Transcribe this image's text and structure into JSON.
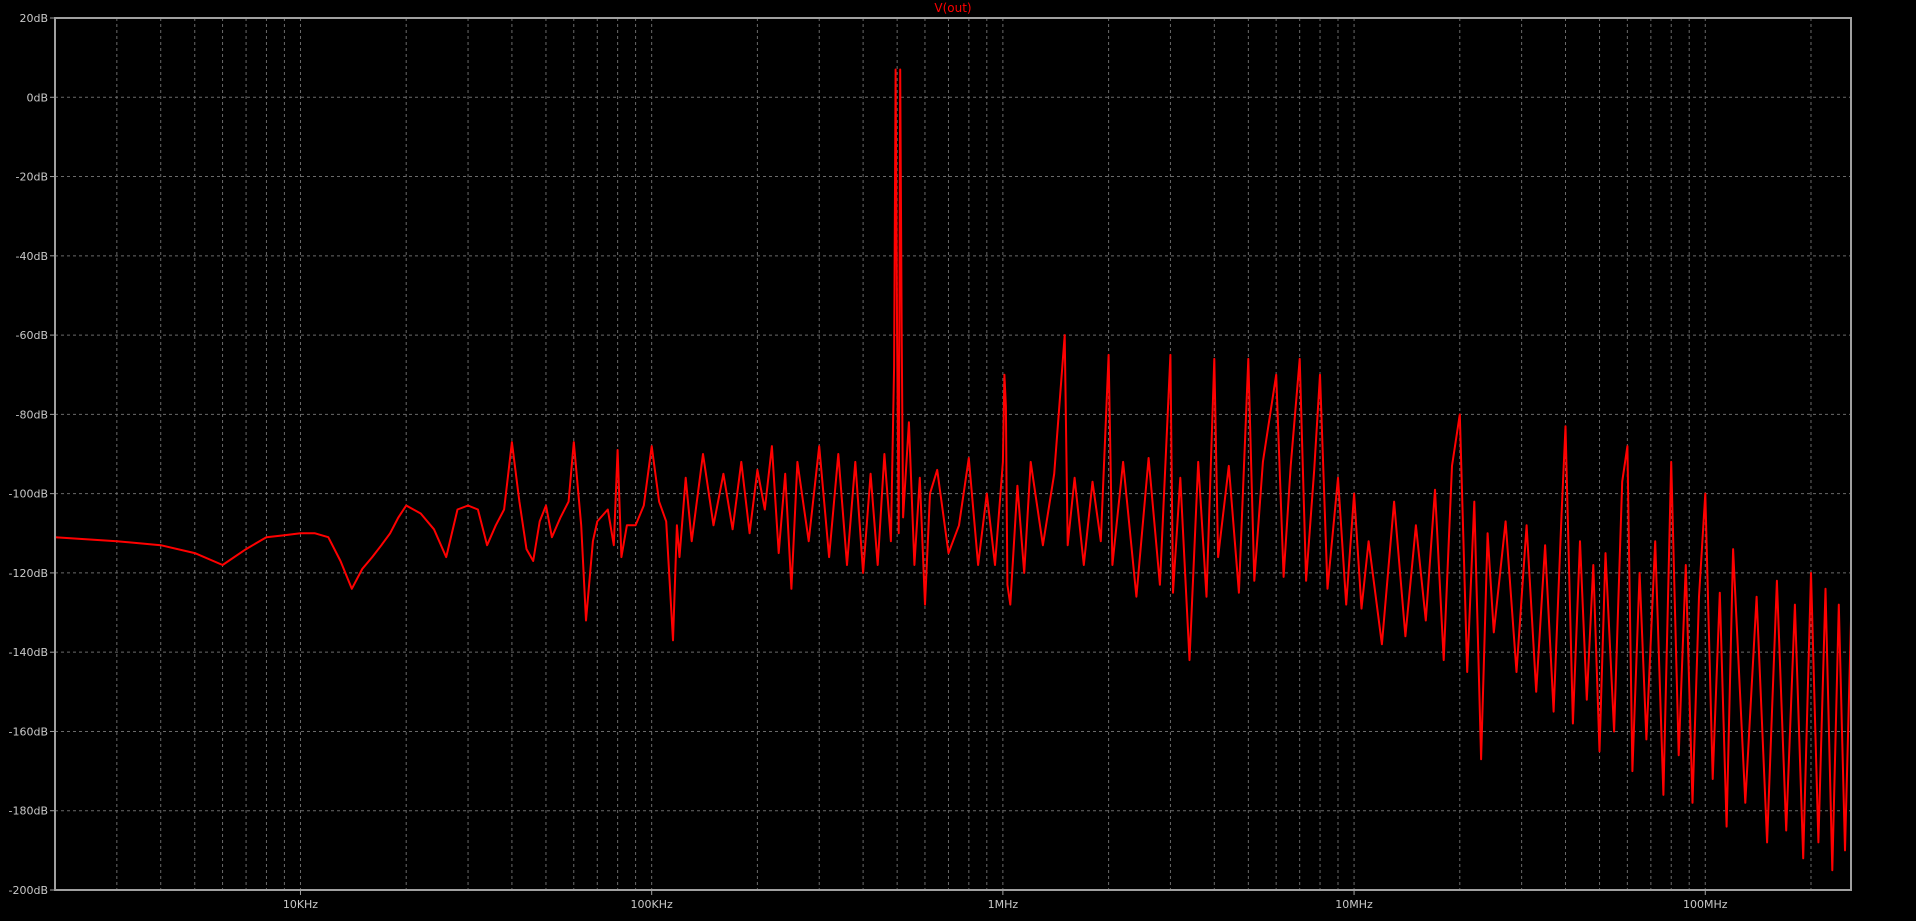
{
  "colors": {
    "background": "#000000",
    "trace": "#ff0000",
    "axis": "#a0a0a0",
    "grid": "#6a6a6a",
    "tick_label": "#c8c8c8"
  },
  "chart_data": {
    "type": "line",
    "title": "V(out)",
    "xlabel": "",
    "ylabel": "",
    "x_scale": "log",
    "xlim": [
      2000,
      260000000
    ],
    "ylim": [
      -200,
      20
    ],
    "grid": true,
    "legend": "none",
    "x_ticks": [
      {
        "value": 10000,
        "label": "10KHz"
      },
      {
        "value": 100000,
        "label": "100KHz"
      },
      {
        "value": 1000000,
        "label": "1MHz"
      },
      {
        "value": 10000000,
        "label": "10MHz"
      },
      {
        "value": 100000000,
        "label": "100MHz"
      }
    ],
    "y_ticks": [
      {
        "value": 20,
        "label": "20dB"
      },
      {
        "value": 0,
        "label": "0dB"
      },
      {
        "value": -20,
        "label": "-20dB"
      },
      {
        "value": -40,
        "label": "-40dB"
      },
      {
        "value": -60,
        "label": "-60dB"
      },
      {
        "value": -80,
        "label": "-80dB"
      },
      {
        "value": -100,
        "label": "-100dB"
      },
      {
        "value": -120,
        "label": "-120dB"
      },
      {
        "value": -140,
        "label": "-140dB"
      },
      {
        "value": -160,
        "label": "-160dB"
      },
      {
        "value": -180,
        "label": "-180dB"
      },
      {
        "value": -200,
        "label": "-200dB"
      }
    ],
    "series": [
      {
        "values": [
          [
            2000,
            -111
          ],
          [
            3000,
            -112
          ],
          [
            4000,
            -113
          ],
          [
            5000,
            -115
          ],
          [
            6000,
            -118
          ],
          [
            7000,
            -114
          ],
          [
            8000,
            -111
          ],
          [
            9000,
            -110.5
          ],
          [
            10000,
            -110
          ],
          [
            11000,
            -110
          ],
          [
            12000,
            -111
          ],
          [
            13000,
            -117
          ],
          [
            14000,
            -124
          ],
          [
            15000,
            -119
          ],
          [
            16000,
            -116
          ],
          [
            17000,
            -113
          ],
          [
            18000,
            -110
          ],
          [
            19000,
            -106
          ],
          [
            20000,
            -103
          ],
          [
            22000,
            -105
          ],
          [
            24000,
            -109
          ],
          [
            26000,
            -116
          ],
          [
            28000,
            -104
          ],
          [
            30000,
            -103
          ],
          [
            32000,
            -104
          ],
          [
            34000,
            -113
          ],
          [
            36000,
            -108
          ],
          [
            38000,
            -104
          ],
          [
            40000,
            -87
          ],
          [
            42000,
            -102
          ],
          [
            44000,
            -114
          ],
          [
            46000,
            -117
          ],
          [
            48000,
            -107
          ],
          [
            50000,
            -103
          ],
          [
            52000,
            -111
          ],
          [
            55000,
            -106
          ],
          [
            58000,
            -102
          ],
          [
            60000,
            -87
          ],
          [
            63000,
            -108
          ],
          [
            65000,
            -132
          ],
          [
            68000,
            -112
          ],
          [
            70000,
            -107
          ],
          [
            75000,
            -104
          ],
          [
            78000,
            -113
          ],
          [
            80000,
            -89
          ],
          [
            82000,
            -116
          ],
          [
            85000,
            -108
          ],
          [
            90000,
            -108
          ],
          [
            95000,
            -103
          ],
          [
            100000,
            -88
          ],
          [
            105000,
            -102
          ],
          [
            110000,
            -107
          ],
          [
            115000,
            -137
          ],
          [
            118000,
            -108
          ],
          [
            120000,
            -116
          ],
          [
            125000,
            -96
          ],
          [
            130000,
            -112
          ],
          [
            140000,
            -90
          ],
          [
            150000,
            -108
          ],
          [
            160000,
            -95
          ],
          [
            170000,
            -109
          ],
          [
            180000,
            -92
          ],
          [
            190000,
            -110
          ],
          [
            200000,
            -94
          ],
          [
            210000,
            -104
          ],
          [
            220000,
            -88
          ],
          [
            230000,
            -115
          ],
          [
            240000,
            -95
          ],
          [
            250000,
            -124
          ],
          [
            260000,
            -92
          ],
          [
            280000,
            -112
          ],
          [
            300000,
            -88
          ],
          [
            320000,
            -116
          ],
          [
            340000,
            -90
          ],
          [
            360000,
            -118
          ],
          [
            380000,
            -92
          ],
          [
            400000,
            -120
          ],
          [
            420000,
            -95
          ],
          [
            440000,
            -118
          ],
          [
            460000,
            -90
          ],
          [
            480000,
            -112
          ],
          [
            490000,
            -68
          ],
          [
            495000,
            7
          ],
          [
            500000,
            -60
          ],
          [
            505000,
            -110
          ],
          [
            510000,
            7
          ],
          [
            515000,
            -60
          ],
          [
            520000,
            -106
          ],
          [
            540000,
            -82
          ],
          [
            560000,
            -118
          ],
          [
            580000,
            -96
          ],
          [
            600000,
            -128
          ],
          [
            620000,
            -100
          ],
          [
            650000,
            -94
          ],
          [
            700000,
            -115
          ],
          [
            750000,
            -108
          ],
          [
            800000,
            -91
          ],
          [
            850000,
            -118
          ],
          [
            900000,
            -100
          ],
          [
            950000,
            -118
          ],
          [
            1000000,
            -92
          ],
          [
            1010000,
            -70
          ],
          [
            1020000,
            -78
          ],
          [
            1030000,
            -123
          ],
          [
            1050000,
            -128
          ],
          [
            1100000,
            -98
          ],
          [
            1150000,
            -120
          ],
          [
            1200000,
            -92
          ],
          [
            1300000,
            -113
          ],
          [
            1400000,
            -95
          ],
          [
            1500000,
            -60
          ],
          [
            1530000,
            -113
          ],
          [
            1600000,
            -96
          ],
          [
            1700000,
            -118
          ],
          [
            1800000,
            -97
          ],
          [
            1900000,
            -112
          ],
          [
            2000000,
            -65
          ],
          [
            2050000,
            -118
          ],
          [
            2200000,
            -92
          ],
          [
            2400000,
            -126
          ],
          [
            2600000,
            -91
          ],
          [
            2800000,
            -123
          ],
          [
            3000000,
            -65
          ],
          [
            3050000,
            -125
          ],
          [
            3200000,
            -96
          ],
          [
            3400000,
            -142
          ],
          [
            3600000,
            -92
          ],
          [
            3800000,
            -126
          ],
          [
            4000000,
            -66
          ],
          [
            4100000,
            -116
          ],
          [
            4400000,
            -93
          ],
          [
            4700000,
            -125
          ],
          [
            5000000,
            -66
          ],
          [
            5200000,
            -122
          ],
          [
            5500000,
            -92
          ],
          [
            6000000,
            -70
          ],
          [
            6300000,
            -121
          ],
          [
            6600000,
            -93
          ],
          [
            7000000,
            -66
          ],
          [
            7300000,
            -122
          ],
          [
            7700000,
            -94
          ],
          [
            8000000,
            -70
          ],
          [
            8400000,
            -124
          ],
          [
            9000000,
            -96
          ],
          [
            9500000,
            -128
          ],
          [
            10000000,
            -100
          ],
          [
            10500000,
            -129
          ],
          [
            11000000,
            -112
          ],
          [
            12000000,
            -138
          ],
          [
            13000000,
            -102
          ],
          [
            14000000,
            -136
          ],
          [
            15000000,
            -108
          ],
          [
            16000000,
            -132
          ],
          [
            17000000,
            -99
          ],
          [
            18000000,
            -142
          ],
          [
            19000000,
            -93
          ],
          [
            20000000,
            -80
          ],
          [
            21000000,
            -145
          ],
          [
            22000000,
            -102
          ],
          [
            23000000,
            -167
          ],
          [
            24000000,
            -110
          ],
          [
            25000000,
            -135
          ],
          [
            27000000,
            -107
          ],
          [
            29000000,
            -145
          ],
          [
            31000000,
            -108
          ],
          [
            33000000,
            -150
          ],
          [
            35000000,
            -113
          ],
          [
            37000000,
            -155
          ],
          [
            39000000,
            -105
          ],
          [
            40000000,
            -83
          ],
          [
            42000000,
            -158
          ],
          [
            44000000,
            -112
          ],
          [
            46000000,
            -152
          ],
          [
            48000000,
            -118
          ],
          [
            50000000,
            -165
          ],
          [
            52000000,
            -115
          ],
          [
            55000000,
            -160
          ],
          [
            58000000,
            -97
          ],
          [
            60000000,
            -88
          ],
          [
            62000000,
            -170
          ],
          [
            65000000,
            -120
          ],
          [
            68000000,
            -162
          ],
          [
            72000000,
            -112
          ],
          [
            76000000,
            -176
          ],
          [
            80000000,
            -92
          ],
          [
            84000000,
            -166
          ],
          [
            88000000,
            -118
          ],
          [
            92000000,
            -178
          ],
          [
            96000000,
            -126
          ],
          [
            100000000,
            -100
          ],
          [
            105000000,
            -172
          ],
          [
            110000000,
            -125
          ],
          [
            115000000,
            -184
          ],
          [
            120000000,
            -114
          ],
          [
            130000000,
            -178
          ],
          [
            140000000,
            -126
          ],
          [
            150000000,
            -188
          ],
          [
            160000000,
            -122
          ],
          [
            170000000,
            -185
          ],
          [
            180000000,
            -128
          ],
          [
            190000000,
            -192
          ],
          [
            200000000,
            -120
          ],
          [
            210000000,
            -188
          ],
          [
            220000000,
            -124
          ],
          [
            230000000,
            -195
          ],
          [
            240000000,
            -128
          ],
          [
            250000000,
            -190
          ],
          [
            260000000,
            -132
          ]
        ]
      }
    ]
  }
}
